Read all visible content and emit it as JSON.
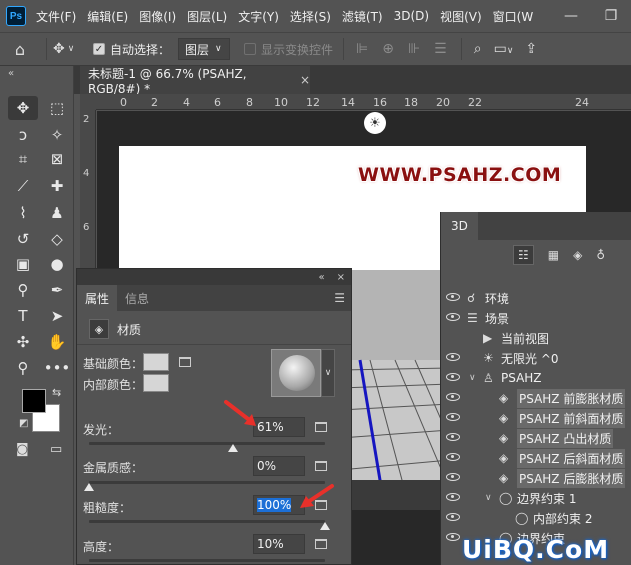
{
  "menubar": {
    "app_icon": "Ps",
    "items": [
      "文件(F)",
      "编辑(E)",
      "图像(I)",
      "图层(L)",
      "文字(Y)",
      "选择(S)",
      "滤镜(T)",
      "3D(D)",
      "视图(V)",
      "窗口(W"
    ],
    "controls": [
      "minimize-icon",
      "restore-icon"
    ]
  },
  "optionsbar": {
    "auto_select_label": "自动选择：",
    "auto_select_checked": true,
    "layer_dropdown": "图层",
    "show_transform_label": "显示变换控件",
    "show_transform_checked": false
  },
  "document": {
    "tab_title": "未标题-1 @ 66.7% (PSAHZ, RGB/8#) *",
    "close_glyph": "×",
    "ruler_ticks": [
      "0",
      "2",
      "4",
      "6",
      "8",
      "10",
      "12",
      "14",
      "16",
      "18",
      "20",
      "22",
      "24"
    ],
    "vruler_ticks": [
      "2",
      "4",
      "6"
    ],
    "watermark": "WWW.PSAHZ.COM"
  },
  "properties": {
    "collapse_glyph": "«",
    "close_glyph": "×",
    "tabs": [
      "属性",
      "信息"
    ],
    "active_tab": 0,
    "section_title": "材质",
    "base_color_label": "基础颜色：",
    "inner_color_label": "内部颜色：",
    "glow_label": "发光：",
    "glow_value": "61%",
    "glow_level": 0.61,
    "metallic_label": "金属质感：",
    "metallic_value": "0%",
    "metallic_level": 0,
    "roughness_label": "粗糙度：",
    "roughness_value": "100%",
    "roughness_level": 1,
    "height_label": "高度：",
    "height_value": "10%",
    "height_level": 0.1
  },
  "panel3d": {
    "tab": "3D",
    "tree": [
      {
        "label": "环境",
        "icon": "environment-icon",
        "indent": 0,
        "eye": true,
        "hl": false
      },
      {
        "label": "场景",
        "icon": "scene-icon",
        "indent": 0,
        "eye": true,
        "hl": false
      },
      {
        "label": "当前视图",
        "icon": "camera-icon",
        "indent": 1,
        "eye": false,
        "hl": false
      },
      {
        "label": "无限光 ^0",
        "icon": "light-icon",
        "indent": 1,
        "eye": true,
        "hl": false
      },
      {
        "label": "PSAHZ",
        "icon": "mesh-icon",
        "indent": 1,
        "eye": true,
        "hl": false,
        "caret": "∨"
      },
      {
        "label": "PSAHZ 前膨胀材质",
        "icon": "material-icon",
        "indent": 2,
        "eye": true,
        "hl": true
      },
      {
        "label": "PSAHZ 前斜面材质",
        "icon": "material-icon",
        "indent": 2,
        "eye": true,
        "hl": true
      },
      {
        "label": "PSAHZ 凸出材质",
        "icon": "material-icon",
        "indent": 2,
        "eye": true,
        "hl": true
      },
      {
        "label": "PSAHZ 后斜面材质",
        "icon": "material-icon",
        "indent": 2,
        "eye": true,
        "hl": true
      },
      {
        "label": "PSAHZ 后膨胀材质",
        "icon": "material-icon",
        "indent": 2,
        "eye": true,
        "hl": true
      },
      {
        "label": "边界约束 1",
        "icon": "constraint-icon",
        "indent": 2,
        "eye": true,
        "hl": false,
        "caret": "∨"
      },
      {
        "label": "内部约束 2",
        "icon": "constraint-icon",
        "indent": 3,
        "eye": true,
        "hl": false
      },
      {
        "label": "边界约束",
        "icon": "constraint-icon",
        "indent": 2,
        "eye": true,
        "hl": false
      }
    ]
  },
  "corner_watermark": "UiBQ.CoM",
  "colors": {
    "arrow": "#e8302a",
    "accent": "#1c6fd6",
    "watermark": "#8a1010"
  }
}
